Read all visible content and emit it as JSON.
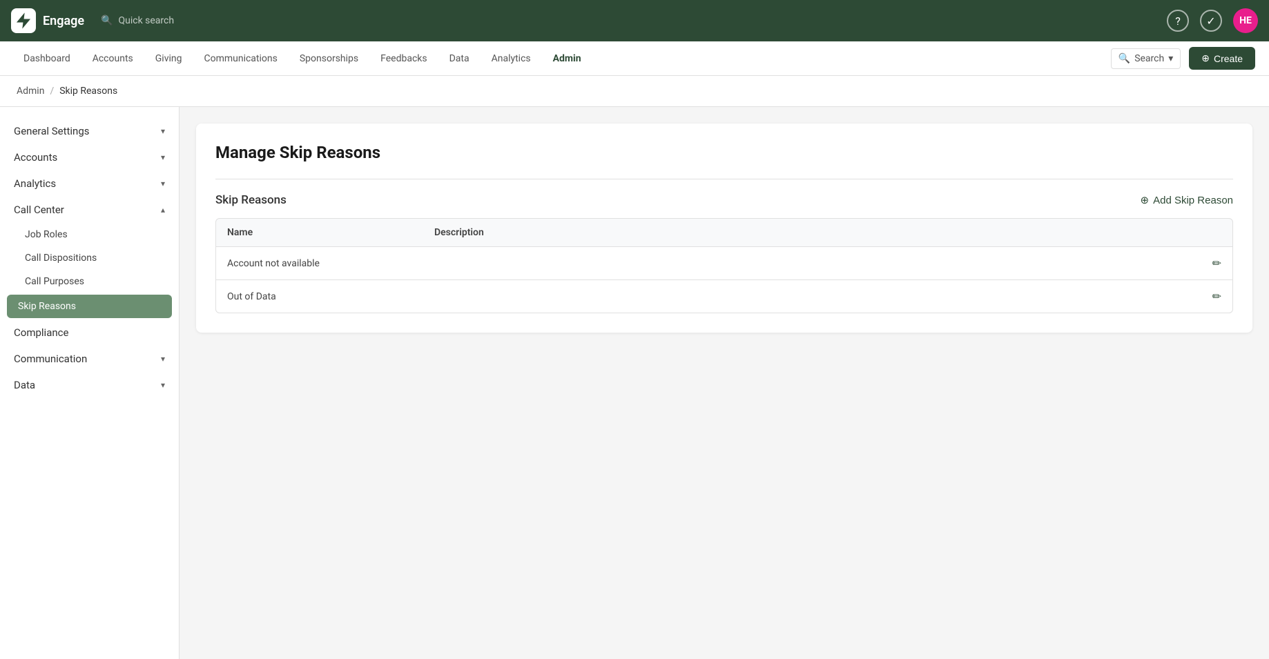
{
  "app": {
    "name": "Engage",
    "quick_search": "Quick search",
    "avatar_initials": "HE"
  },
  "nav": {
    "items": [
      {
        "id": "dashboard",
        "label": "Dashboard"
      },
      {
        "id": "accounts",
        "label": "Accounts"
      },
      {
        "id": "giving",
        "label": "Giving"
      },
      {
        "id": "communications",
        "label": "Communications"
      },
      {
        "id": "sponsorships",
        "label": "Sponsorships"
      },
      {
        "id": "feedbacks",
        "label": "Feedbacks"
      },
      {
        "id": "data",
        "label": "Data"
      },
      {
        "id": "analytics",
        "label": "Analytics"
      },
      {
        "id": "admin",
        "label": "Admin",
        "active": true
      }
    ],
    "search_label": "Search",
    "create_label": "Create"
  },
  "breadcrumb": {
    "parent": "Admin",
    "separator": "/",
    "current": "Skip Reasons"
  },
  "sidebar": {
    "sections": [
      {
        "id": "general-settings",
        "label": "General Settings",
        "expanded": false,
        "has_children": true
      },
      {
        "id": "accounts",
        "label": "Accounts",
        "expanded": false,
        "has_children": true
      },
      {
        "id": "analytics",
        "label": "Analytics",
        "expanded": false,
        "has_children": true
      },
      {
        "id": "call-center",
        "label": "Call Center",
        "expanded": true,
        "has_children": true,
        "children": [
          {
            "id": "job-roles",
            "label": "Job Roles",
            "active": false
          },
          {
            "id": "call-dispositions",
            "label": "Call Dispositions",
            "active": false
          },
          {
            "id": "call-purposes",
            "label": "Call Purposes",
            "active": false
          },
          {
            "id": "skip-reasons",
            "label": "Skip Reasons",
            "active": true
          }
        ]
      },
      {
        "id": "compliance",
        "label": "Compliance",
        "expanded": false,
        "has_children": false
      },
      {
        "id": "communication",
        "label": "Communication",
        "expanded": false,
        "has_children": true
      },
      {
        "id": "data",
        "label": "Data",
        "expanded": false,
        "has_children": true
      }
    ]
  },
  "main": {
    "title": "Manage Skip Reasons",
    "section_title": "Skip Reasons",
    "add_button": "Add Skip Reason",
    "table": {
      "columns": [
        "Name",
        "Description"
      ],
      "rows": [
        {
          "name": "Account not available",
          "description": ""
        },
        {
          "name": "Out of Data",
          "description": ""
        }
      ]
    }
  }
}
